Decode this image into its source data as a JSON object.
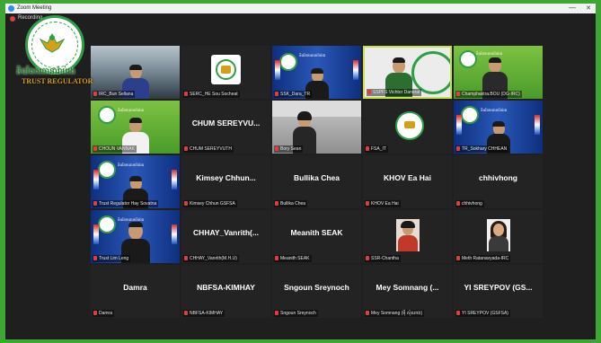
{
  "window": {
    "title": "Zoom Meeting",
    "minimize": "—",
    "close": "✕"
  },
  "recording": {
    "label": "Recording..."
  },
  "brand": {
    "name_kh": "និយ័តករធានារ៉ាប់រង",
    "name_en": "TRUST REGULATOR"
  },
  "participants": [
    {
      "id": "p1",
      "label": "IRC_Bun Sellana",
      "name": "",
      "kind": "video-office"
    },
    {
      "id": "p2",
      "label": "SERC_HE Sou Socheat",
      "name": "",
      "kind": "logo"
    },
    {
      "id": "p3",
      "label": "SSK_Dara_TR",
      "name": "",
      "kind": "video-slide"
    },
    {
      "id": "p4",
      "label": "SSPFS Vichtor Daneral",
      "name": "",
      "kind": "video-logo"
    },
    {
      "id": "p5",
      "label": "Champhaktra.BOU (DG-IRC)",
      "name": "",
      "kind": "video-green"
    },
    {
      "id": "p6",
      "label": "CHOUN VANNAK",
      "name": "",
      "kind": "video-green"
    },
    {
      "id": "p7",
      "label": "CHUM SEREYVUTH",
      "name": "CHUM SEREYVU...",
      "kind": "name"
    },
    {
      "id": "p8",
      "label": "Bory Sean",
      "name": "",
      "kind": "video-room"
    },
    {
      "id": "p9",
      "label": "FSA_IT",
      "name": "",
      "kind": "logo-small"
    },
    {
      "id": "p10",
      "label": "TR_Sokhary CHHEAN",
      "name": "",
      "kind": "video-slide"
    },
    {
      "id": "p11",
      "label": "Trust Regulator Hay Sovatna",
      "name": "",
      "kind": "video-slide"
    },
    {
      "id": "p12",
      "label": "Kimsey Chhun GSFSA",
      "name": "Kimsey Chhun...",
      "kind": "name"
    },
    {
      "id": "p13",
      "label": "Bullika Chea",
      "name": "Bullika Chea",
      "kind": "name"
    },
    {
      "id": "p14",
      "label": "KHOV Ea Hai",
      "name": "KHOV Ea Hai",
      "kind": "name"
    },
    {
      "id": "p15",
      "label": "chhivhong",
      "name": "chhivhong",
      "kind": "name"
    },
    {
      "id": "p16",
      "label": "Trust Lim Leng",
      "name": "",
      "kind": "video-slide"
    },
    {
      "id": "p17",
      "label": "CHHAY_Vanrith(M.H.U)",
      "name": "CHHAY_Vanrith(...",
      "kind": "name"
    },
    {
      "id": "p18",
      "label": "Meanith SEAK",
      "name": "Meanith SEAK",
      "kind": "name"
    },
    {
      "id": "p19",
      "label": "SSR-Chantha",
      "name": "",
      "kind": "photo"
    },
    {
      "id": "p20",
      "label": "Meth Ratanavyada-IRC",
      "name": "",
      "kind": "photo"
    },
    {
      "id": "p21",
      "label": "Damra",
      "name": "Damra",
      "kind": "name"
    },
    {
      "id": "p22",
      "label": "NBFSA-KIMHAY",
      "name": "NBFSA-KIMHAY",
      "kind": "name"
    },
    {
      "id": "p23",
      "label": "Sngoun Sreynoch",
      "name": "Sngoun Sreynoch",
      "kind": "name"
    },
    {
      "id": "p24",
      "label": "Mey Somnang (ម៉ី សុំណាង)",
      "name": "Mey Somnang (...",
      "kind": "name"
    },
    {
      "id": "p25",
      "label": "YI SREYPOV (GSFSA)",
      "name": "YI SREYPOV (GS...",
      "kind": "name"
    }
  ],
  "colors": {
    "background": "#3fa535",
    "tile": "#232323",
    "mic_muted": "#e23c3c",
    "accent": "#2d8cff"
  }
}
